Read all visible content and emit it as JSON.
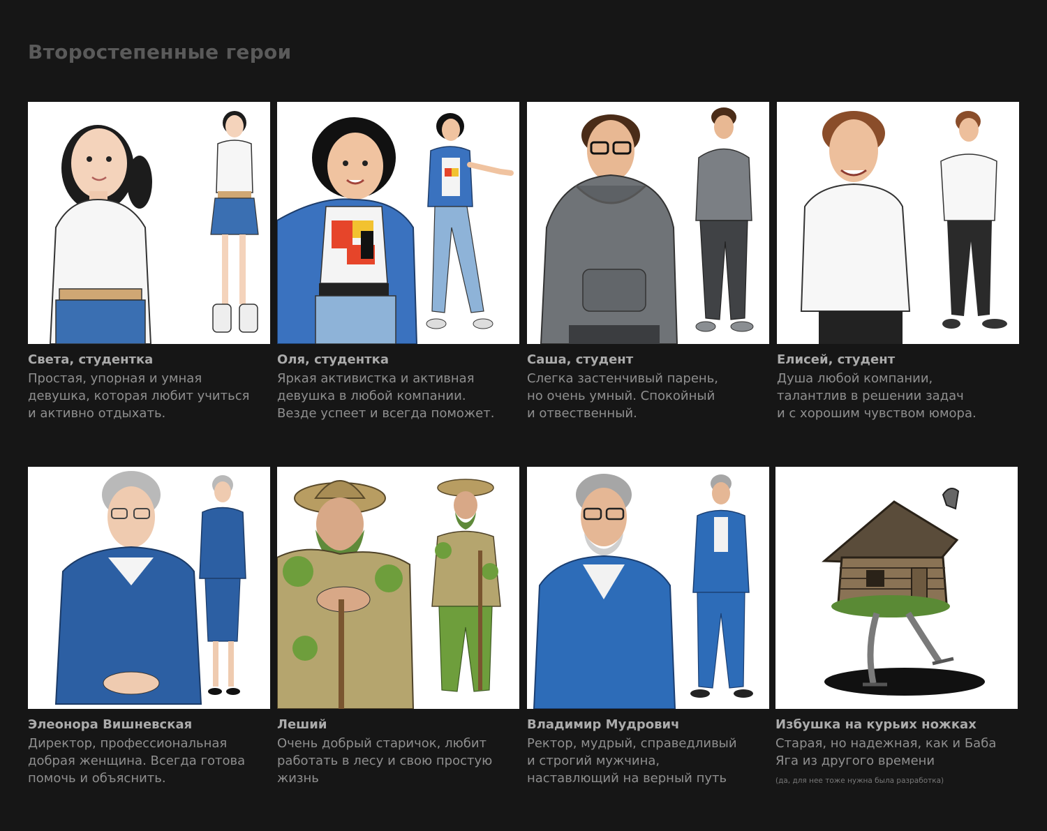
{
  "page": {
    "title": "Второстепенные герои"
  },
  "characters": [
    {
      "name": "Света, студентка",
      "description": "Простая, упорная и умная\nдевушка, которая любит учиться\nи активно отдыхать."
    },
    {
      "name": "Оля, студентка",
      "description": "Яркая активистка и активная\nдевушка в любой компании.\nВезде успеет и всегда поможет."
    },
    {
      "name": "Саша, студент",
      "description": "Слегка застенчивый парень,\nно очень умный. Спокойный\nи отвественный."
    },
    {
      "name": "Елисей, студент",
      "description": "Душа любой компании,\nталантлив в решении задач\nи с хорошим чувством юмора."
    },
    {
      "name": "Элеонора Вишневская",
      "description": "Директор, профессиональная\nдобрая женщина. Всегда готова\nпомочь и объяснить."
    },
    {
      "name": "Леший",
      "description": "Очень добрый старичок, любит\nработать в лесу и свою простую\nжизнь"
    },
    {
      "name": "Владимир Мудрович",
      "description": "Ректор, мудрый, справедливый\nи строгий мужчина,\nнаставлющий на верный путь"
    },
    {
      "name": "Избушка на курьих ножках",
      "description": "Старая, но надежная, как и Баба\nЯга из другого времени",
      "note": "(да, для нее тоже нужна была разработка)"
    }
  ],
  "colors": {
    "background": "#161616",
    "title": "#5a5a5a",
    "name": "#ababab",
    "description": "#8f8f8f"
  }
}
